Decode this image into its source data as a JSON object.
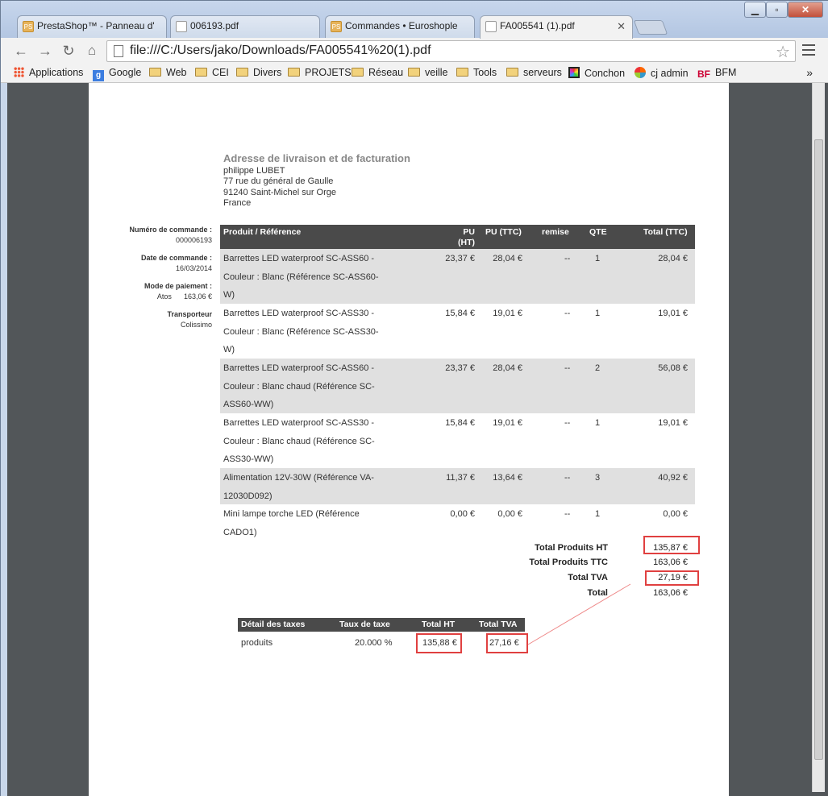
{
  "window": {
    "tabs": [
      {
        "title": "PrestaShop™ - Panneau d'",
        "icon": "prestashop-icon"
      },
      {
        "title": "006193.pdf",
        "icon": "document-icon"
      },
      {
        "title": "Commandes • Euroshople",
        "icon": "prestashop-icon"
      },
      {
        "title": "FA005541 (1).pdf",
        "icon": "document-icon"
      }
    ],
    "controls": {
      "minimize": "▁",
      "maximize": "▫",
      "close": "✕"
    }
  },
  "toolbar": {
    "url": "file:///C:/Users/jako/Downloads/FA005541%20(1).pdf"
  },
  "bookmarks": [
    {
      "label": "Applications",
      "icon": "apps-icon"
    },
    {
      "label": "Google",
      "icon": "google-icon"
    },
    {
      "label": "Web",
      "icon": "folder-icon"
    },
    {
      "label": "CEI",
      "icon": "folder-icon"
    },
    {
      "label": "Divers",
      "icon": "folder-icon"
    },
    {
      "label": "PROJETS",
      "icon": "folder-icon"
    },
    {
      "label": "Réseau",
      "icon": "folder-icon"
    },
    {
      "label": "veille",
      "icon": "folder-icon"
    },
    {
      "label": "Tools",
      "icon": "folder-icon"
    },
    {
      "label": "serveurs",
      "icon": "folder-icon"
    },
    {
      "label": "Conchon",
      "icon": "conchon-icon"
    },
    {
      "label": "cj admin",
      "icon": "joomla-icon"
    },
    {
      "label": "BFM",
      "icon": "bfm-icon"
    }
  ],
  "invoice": {
    "address_title": "Adresse de livraison et de facturation",
    "address_lines": [
      "philippe LUBET",
      "77 rue du général de Gaulle",
      "91240 Saint-Michel sur Orge",
      "France"
    ],
    "side": {
      "order_no_label": "Numéro de commande :",
      "order_no": "000006193",
      "date_label": "Date de commande :",
      "date": "16/03/2014",
      "payment_label": "Mode de paiement :",
      "payment_method": "Atos",
      "payment_amount": "163,06 €",
      "carrier_label": "Transporteur",
      "carrier": "Colissimo"
    },
    "headers": {
      "product": "Produit / Référence",
      "pu_ht": "PU (HT)",
      "pu_ttc": "PU (TTC)",
      "remise": "remise",
      "qte": "QTE",
      "total": "Total (TTC)"
    },
    "rows": [
      {
        "product": "Barrettes LED waterproof SC-ASS60 - Couleur : Blanc (Référence SC-ASS60-W)",
        "pu_ht": "23,37 €",
        "pu_ttc": "28,04 €",
        "remise": "--",
        "qte": "1",
        "total": "28,04 €"
      },
      {
        "product": "Barrettes LED waterproof SC-ASS30 - Couleur : Blanc (Référence SC-ASS30-W)",
        "pu_ht": "15,84 €",
        "pu_ttc": "19,01 €",
        "remise": "--",
        "qte": "1",
        "total": "19,01 €"
      },
      {
        "product": "Barrettes LED waterproof SC-ASS60 - Couleur : Blanc chaud (Référence SC-ASS60-WW)",
        "pu_ht": "23,37 €",
        "pu_ttc": "28,04 €",
        "remise": "--",
        "qte": "2",
        "total": "56,08 €"
      },
      {
        "product": "Barrettes LED waterproof SC-ASS30 - Couleur : Blanc chaud (Référence SC-ASS30-WW)",
        "pu_ht": "15,84 €",
        "pu_ttc": "19,01 €",
        "remise": "--",
        "qte": "1",
        "total": "19,01 €"
      },
      {
        "product": "Alimentation 12V-30W (Référence VA-12030D092)",
        "pu_ht": "11,37 €",
        "pu_ttc": "13,64 €",
        "remise": "--",
        "qte": "3",
        "total": "40,92 €"
      },
      {
        "product": "Mini lampe torche LED (Référence CADO1)",
        "pu_ht": "0,00 €",
        "pu_ttc": "0,00 €",
        "remise": "--",
        "qte": "1",
        "total": "0,00 €"
      }
    ],
    "totals": [
      {
        "label": "Total Produits HT",
        "value": "135,87 €"
      },
      {
        "label": "Total Produits TTC",
        "value": "163,06 €"
      },
      {
        "label": "Total TVA",
        "value": "27,19 €"
      },
      {
        "label": "Total",
        "value": "163,06 €"
      }
    ],
    "tax": {
      "headers": {
        "detail": "Détail des taxes",
        "rate": "Taux de taxe",
        "ht": "Total HT",
        "tva": "Total TVA"
      },
      "row": {
        "detail": "produits",
        "rate": "20.000 %",
        "ht": "135,88 €",
        "tva": "27,16 €"
      }
    },
    "highlight_color": "#e04040"
  }
}
